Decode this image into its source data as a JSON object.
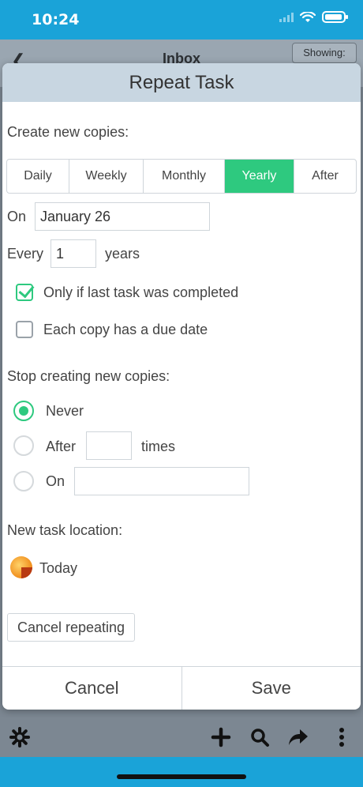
{
  "status_bar": {
    "time": "10:24"
  },
  "background_app": {
    "title": "Inbox",
    "showing_label": "Showing:"
  },
  "dialog": {
    "title": "Repeat Task",
    "create_label": "Create new copies:",
    "frequency_options": [
      "Daily",
      "Weekly",
      "Monthly",
      "Yearly",
      "After"
    ],
    "selected_frequency": "Yearly",
    "on_label": "On",
    "on_value": "January 26",
    "every_label": "Every",
    "every_value": "1",
    "every_unit": "years",
    "only_if_completed": {
      "label": "Only if last task was completed",
      "checked": true
    },
    "copy_due_date": {
      "label": "Each copy has a due date",
      "checked": false
    },
    "stop_label": "Stop creating new copies:",
    "stop_options": {
      "never": {
        "label": "Never",
        "selected": true
      },
      "after": {
        "label": "After",
        "suffix": "times",
        "value": ""
      },
      "on": {
        "label": "On",
        "value": ""
      }
    },
    "location_label": "New task location:",
    "location_value": "Today",
    "cancel_repeating_label": "Cancel repeating",
    "cancel_label": "Cancel",
    "save_label": "Save"
  },
  "colors": {
    "accent": "#2ec97f",
    "header": "#c8d6e1",
    "brand": "#1aa3d8"
  },
  "icons": [
    "back-icon",
    "wifi-icon",
    "battery-icon",
    "gear-icon",
    "plus-icon",
    "search-icon",
    "share-icon",
    "more-icon",
    "today-icon"
  ]
}
